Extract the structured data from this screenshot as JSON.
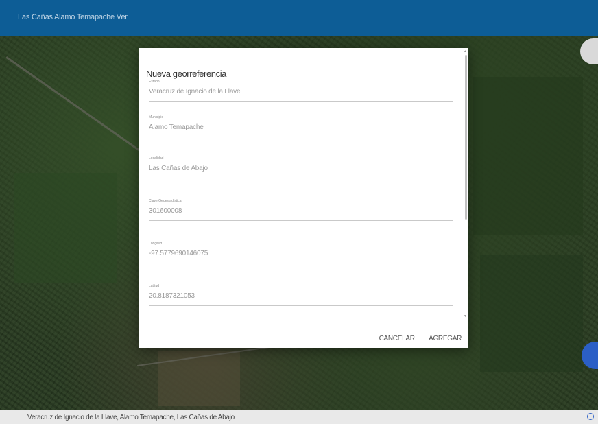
{
  "topbar": {
    "title": "Las Cañas Alamo Temapache Ver"
  },
  "dialog": {
    "heading": "Nueva georreferencia",
    "fields": [
      {
        "label": "Estado",
        "value": "Veracruz de Ignacio de la Llave"
      },
      {
        "label": "Municipio",
        "value": "Alamo Temapache"
      },
      {
        "label": "Localidad",
        "value": "Las Cañas de Abajo"
      },
      {
        "label": "Clave Geoestadística",
        "value": "301600008"
      },
      {
        "label": "Longitud",
        "value": "-97.5779690146075"
      },
      {
        "label": "Latitud",
        "value": "20.8187321053"
      }
    ],
    "cancel_label": "CANCELAR",
    "add_label": "AGREGAR"
  },
  "bottombar": {
    "text": "Veracruz de Ignacio de la Llave, Alamo Temapache, Las Cañas de Abajo"
  },
  "colors": {
    "topbar": "#0d5d96",
    "fab_bottom": "#2b5fc6",
    "dialog_bg": "#ffffff"
  }
}
